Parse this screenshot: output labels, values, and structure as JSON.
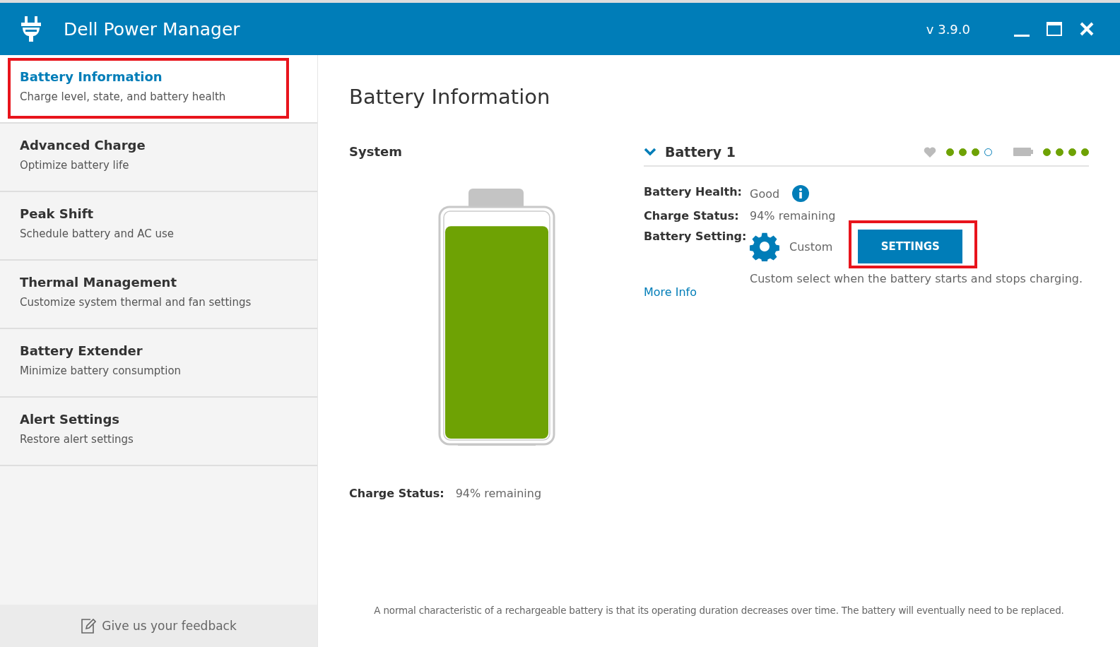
{
  "window": {
    "title": "Dell Power Manager",
    "version": "v 3.9.0"
  },
  "sidebar": {
    "items": [
      {
        "title": "Battery Information",
        "subtitle": "Charge level, state, and battery health",
        "selected": true,
        "highlighted": true
      },
      {
        "title": "Advanced Charge",
        "subtitle": "Optimize battery life",
        "selected": false,
        "highlighted": false
      },
      {
        "title": "Peak Shift",
        "subtitle": "Schedule battery and AC use",
        "selected": false,
        "highlighted": false
      },
      {
        "title": "Thermal Management",
        "subtitle": "Customize system thermal and fan settings",
        "selected": false,
        "highlighted": false
      },
      {
        "title": "Battery Extender",
        "subtitle": "Minimize battery consumption",
        "selected": false,
        "highlighted": false
      },
      {
        "title": "Alert Settings",
        "subtitle": "Restore alert settings",
        "selected": false,
        "highlighted": false
      }
    ],
    "feedback": "Give us your feedback"
  },
  "page_title": "Battery Information",
  "system": {
    "heading": "System",
    "level": 0.94,
    "charge_label": "Charge Status:",
    "charge_value": "94% remaining"
  },
  "battery": {
    "name": "Battery 1",
    "expanded": true,
    "health": {
      "stars": 3
    },
    "charge": {
      "stars": 4
    },
    "rows": [
      {
        "label": "Battery Health:",
        "value": "Good"
      },
      {
        "label": "Charge Status:",
        "value": "94% remaining"
      },
      {
        "label": "Battery Setting:",
        "value": "Custom"
      }
    ],
    "settings_button": {
      "label": "SETTINGS",
      "highlighted": true
    },
    "description": "Custom select when the battery starts and stops charging.",
    "more_info": "More Info"
  },
  "footer_note": "A normal characteristic of a rechargeable battery is that its operating duration decreases over time. The battery will eventually need to be replaced."
}
